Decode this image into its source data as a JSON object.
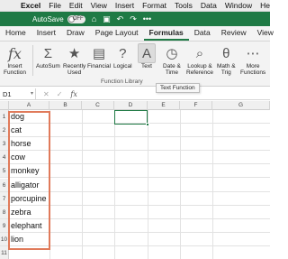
{
  "menubar": {
    "apple": "",
    "items": [
      {
        "label": "Excel",
        "bold": true
      },
      {
        "label": "File"
      },
      {
        "label": "Edit"
      },
      {
        "label": "View"
      },
      {
        "label": "Insert"
      },
      {
        "label": "Format"
      },
      {
        "label": "Tools"
      },
      {
        "label": "Data"
      },
      {
        "label": "Window"
      },
      {
        "label": "He"
      }
    ]
  },
  "titlebar": {
    "autosave_label": "AutoSave",
    "toggle_state": "OFF",
    "icons": [
      "home-icon",
      "save-icon",
      "undo-icon",
      "redo-icon",
      "more-icon"
    ]
  },
  "tabs": [
    {
      "label": "Home"
    },
    {
      "label": "Insert"
    },
    {
      "label": "Draw"
    },
    {
      "label": "Page Layout"
    },
    {
      "label": "Formulas",
      "active": true
    },
    {
      "label": "Data"
    },
    {
      "label": "Review"
    },
    {
      "label": "View"
    }
  ],
  "ribbon": {
    "insert_function": {
      "label": "Insert\nFunction",
      "glyph": "fx"
    },
    "buttons": [
      {
        "id": "autosum",
        "label": "AutoSum",
        "glyph": "Σ"
      },
      {
        "id": "recently-used",
        "label": "Recently\nUsed",
        "glyph": "★"
      },
      {
        "id": "financial",
        "label": "Financial",
        "glyph": "▤"
      },
      {
        "id": "logical",
        "label": "Logical",
        "glyph": "?"
      },
      {
        "id": "text",
        "label": "Text",
        "glyph": "A"
      },
      {
        "id": "date-time",
        "label": "Date &\nTime",
        "glyph": "◷"
      },
      {
        "id": "lookup-reference",
        "label": "Lookup &\nReference",
        "glyph": "⌕"
      },
      {
        "id": "math-trig",
        "label": "Math &\nTrig",
        "glyph": "θ"
      },
      {
        "id": "more-functions",
        "label": "More\nFunctions",
        "glyph": "⋯"
      }
    ],
    "group_label": "Function Library"
  },
  "tooltip": "Text Function",
  "formula_bar": {
    "name_box": "D1",
    "cancel_icon": "✕",
    "enter_icon": "✓",
    "fx_label": "fx",
    "content": ""
  },
  "columns": [
    "A",
    "B",
    "C",
    "D",
    "E",
    "F",
    "G"
  ],
  "rows": [
    {
      "num": "1",
      "a": "dog"
    },
    {
      "num": "2",
      "a": "cat"
    },
    {
      "num": "3",
      "a": "horse"
    },
    {
      "num": "4",
      "a": "cow"
    },
    {
      "num": "5",
      "a": "monkey"
    },
    {
      "num": "6",
      "a": "alligator"
    },
    {
      "num": "7",
      "a": "porcupine"
    },
    {
      "num": "8",
      "a": "zebra"
    },
    {
      "num": "9",
      "a": "elephant"
    },
    {
      "num": "10",
      "a": "lion"
    },
    {
      "num": "11",
      "a": ""
    }
  ],
  "colors": {
    "excel_green": "#1f7a45",
    "selection_highlight": "#e07a5a"
  }
}
